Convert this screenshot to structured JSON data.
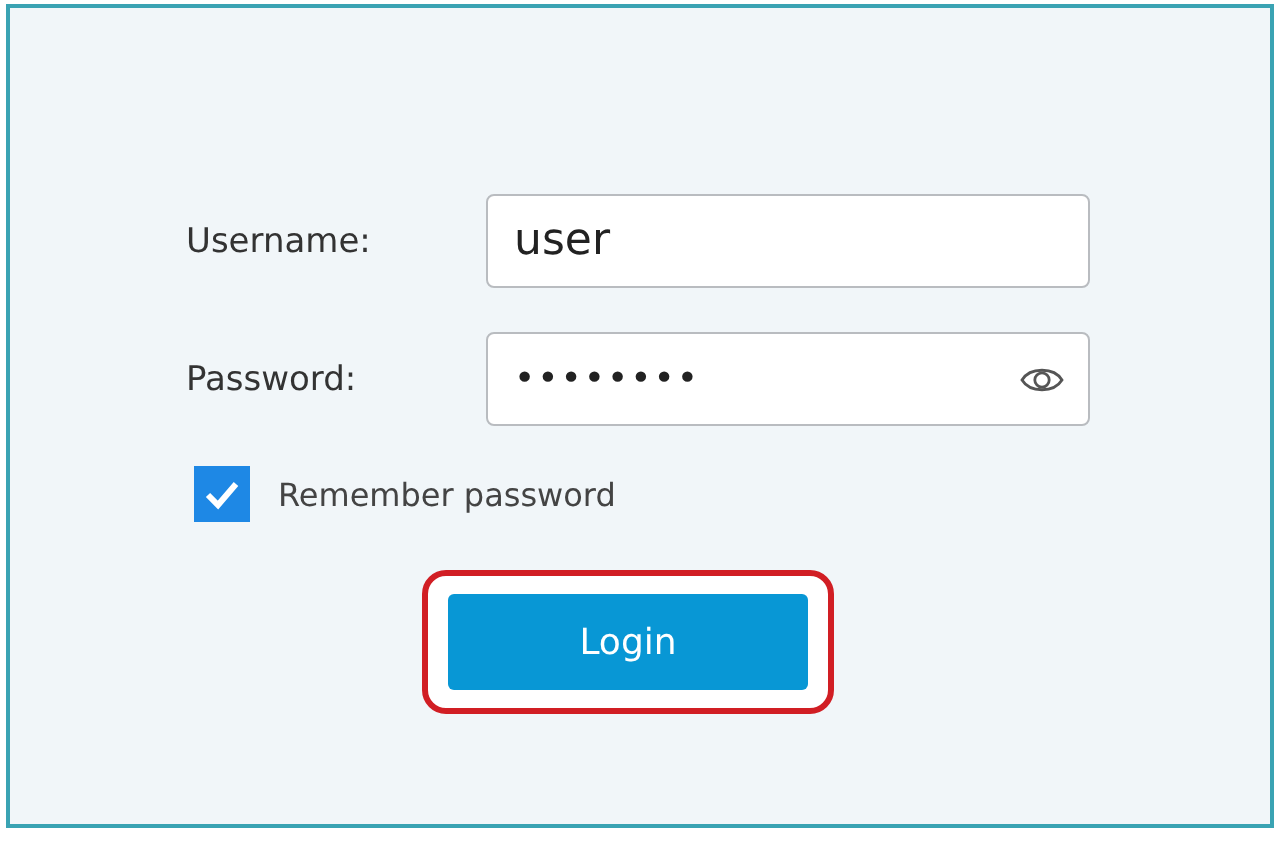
{
  "fields": [
    {
      "label": "Username:",
      "value": "user",
      "kind": "text"
    },
    {
      "label": "Password:",
      "value": "••••••••",
      "kind": "password"
    }
  ],
  "remember": {
    "label": "Remember password",
    "checked": true
  },
  "login_button": {
    "label": "Login",
    "highlighted": true
  }
}
